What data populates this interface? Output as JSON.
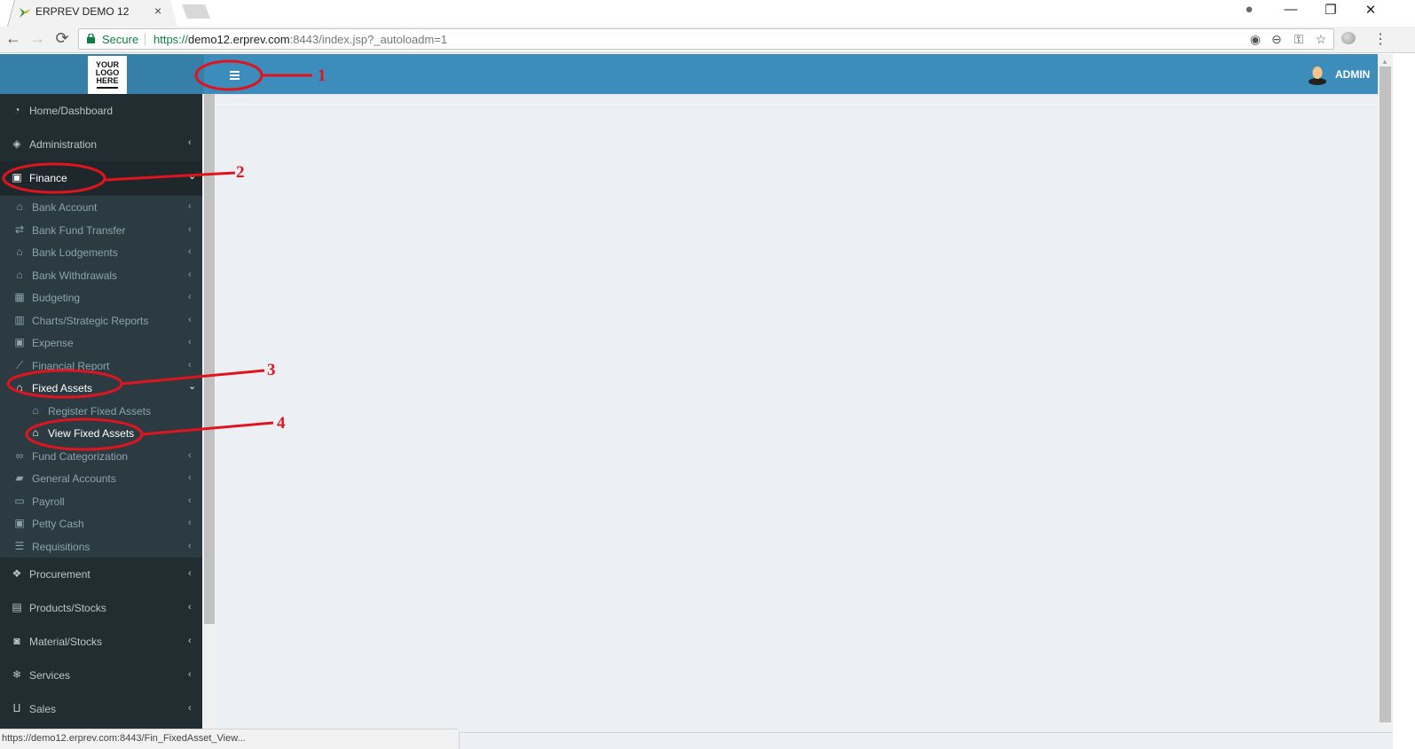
{
  "browser": {
    "tab_title": "ERPREV DEMO 12",
    "tab_close": "×",
    "security_label": "Secure",
    "url": {
      "scheme": "https://",
      "host": "demo12.erprev.com",
      "rest": ":8443/index.jsp?_autoloadm=1"
    },
    "icons": {
      "back": "←",
      "forward": "→",
      "reload": "⟳",
      "location": "◉",
      "zoom": "⊖",
      "key": "⚿",
      "star": "☆",
      "menu": "⋮",
      "profile": "●",
      "minimize": "—",
      "restore": "❐",
      "close": "✕"
    },
    "status_text": "https://demo12.erprev.com:8443/Fin_FixedAsset_View..."
  },
  "header": {
    "logo_lines": [
      "YOUR",
      "LOGO",
      "HERE"
    ],
    "user_name": "ADMIN",
    "accent_color": "#3c8dbc"
  },
  "sidebar": {
    "top_items": [
      {
        "label": "Home/Dashboard",
        "icon": "dashboard-icon",
        "glyph": "◔"
      },
      {
        "label": "Administration",
        "icon": "ticket-icon",
        "glyph": "◈",
        "chevron": "‹"
      },
      {
        "label": "Finance",
        "icon": "money-icon",
        "glyph": "▣",
        "chevron": "⌄",
        "active": true
      }
    ],
    "finance_items": [
      {
        "label": "Bank Account",
        "icon": "bank-icon",
        "glyph": "🏛",
        "chevron": "‹"
      },
      {
        "label": "Bank Fund Transfer",
        "icon": "exchange-icon",
        "glyph": "⇄",
        "chevron": "‹"
      },
      {
        "label": "Bank Lodgements",
        "icon": "bank-icon",
        "glyph": "🏛",
        "chevron": "‹"
      },
      {
        "label": "Bank Withdrawals",
        "icon": "bank-icon",
        "glyph": "🏛",
        "chevron": "‹"
      },
      {
        "label": "Budgeting",
        "icon": "calculator-icon",
        "glyph": "▦",
        "chevron": "‹"
      },
      {
        "label": "Charts/Strategic Reports",
        "icon": "bar-chart-icon",
        "glyph": "▥",
        "chevron": "‹"
      },
      {
        "label": "Expense",
        "icon": "money-icon",
        "glyph": "▣",
        "chevron": "‹"
      },
      {
        "label": "Financial Report",
        "icon": "line-chart-icon",
        "glyph": "⟋",
        "chevron": "‹"
      },
      {
        "label": "Fixed Assets",
        "icon": "bank-icon",
        "glyph": "🏛",
        "chevron": "⌄",
        "open": true
      },
      {
        "label": "Register Fixed Assets",
        "icon": "bank-icon",
        "glyph": "🏛",
        "level": 2
      },
      {
        "label": "View Fixed Assets",
        "icon": "bank-icon",
        "glyph": "🏛",
        "level": 2,
        "active": true
      },
      {
        "label": "Fund Categorization",
        "icon": "link-icon",
        "glyph": "∞",
        "chevron": "‹"
      },
      {
        "label": "General Accounts",
        "icon": "book-icon",
        "glyph": "▰",
        "chevron": "‹"
      },
      {
        "label": "Payroll",
        "icon": "credit-card-icon",
        "glyph": "▭",
        "chevron": "‹"
      },
      {
        "label": "Petty Cash",
        "icon": "money-icon",
        "glyph": "▣",
        "chevron": "‹"
      },
      {
        "label": "Requisitions",
        "icon": "list-icon",
        "glyph": "☰",
        "chevron": "‹"
      }
    ],
    "bottom_items": [
      {
        "label": "Procurement",
        "icon": "cubes-icon",
        "glyph": "❖",
        "chevron": "‹"
      },
      {
        "label": "Products/Stocks",
        "icon": "building-icon",
        "glyph": "▤",
        "chevron": "‹"
      },
      {
        "label": "Material/Stocks",
        "icon": "trash-can-icon",
        "glyph": "◙",
        "chevron": "‹"
      },
      {
        "label": "Services",
        "icon": "snowflake-icon",
        "glyph": "❄",
        "chevron": "‹"
      },
      {
        "label": "Sales",
        "icon": "cart-icon",
        "glyph": "🛒",
        "chevron": "‹"
      }
    ]
  },
  "annotations": [
    {
      "number": "1",
      "target": "sidebar-toggle"
    },
    {
      "number": "2",
      "target": "Finance"
    },
    {
      "number": "3",
      "target": "Fixed Assets"
    },
    {
      "number": "4",
      "target": "View Fixed Assets"
    }
  ]
}
